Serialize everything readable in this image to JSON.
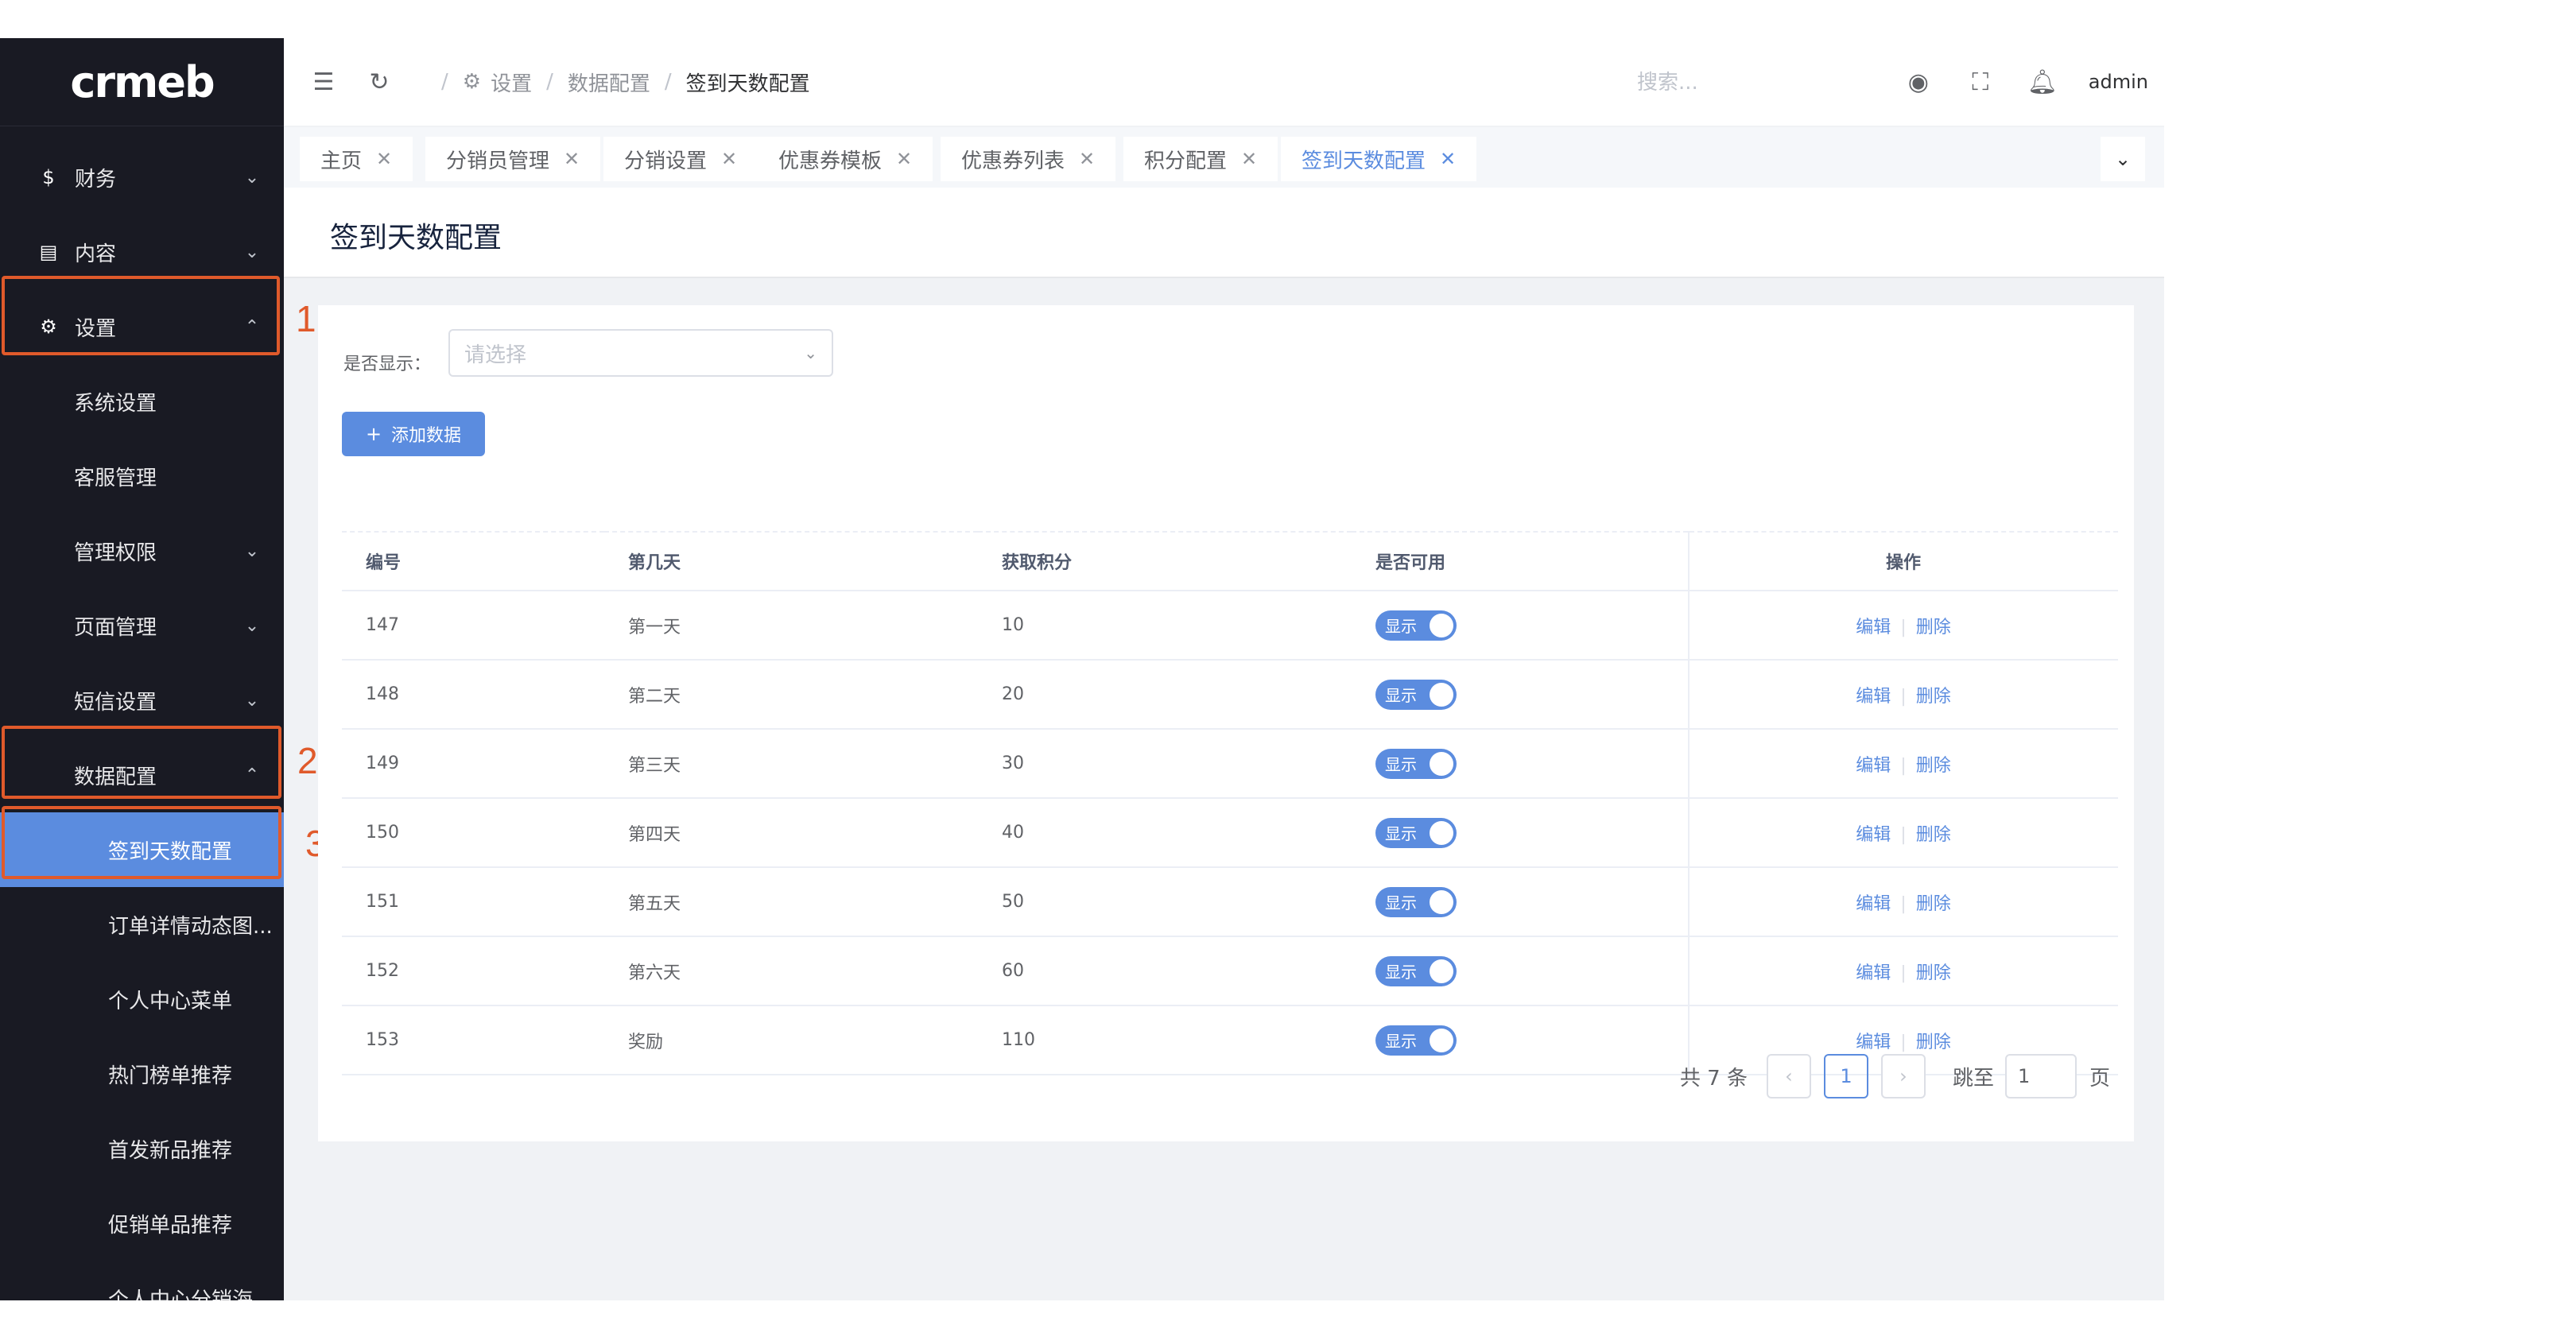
{
  "sidebar": {
    "logo": "crmeb",
    "items": [
      {
        "label": "财务",
        "icon": "dollar-icon",
        "glyph": "$",
        "arrow": "⌄"
      },
      {
        "label": "内容",
        "icon": "book-icon",
        "glyph": "▤",
        "arrow": "⌄"
      },
      {
        "label": "设置",
        "icon": "gear-icon",
        "glyph": "⚙",
        "arrow": "⌃"
      },
      {
        "label": "系统设置"
      },
      {
        "label": "客服管理"
      },
      {
        "label": "管理权限",
        "arrow": "⌄"
      },
      {
        "label": "页面管理",
        "arrow": "⌄"
      },
      {
        "label": "短信设置",
        "arrow": "⌄"
      },
      {
        "label": "数据配置",
        "arrow": "⌃"
      },
      {
        "label": "签到天数配置"
      },
      {
        "label": "订单详情动态图..."
      },
      {
        "label": "个人中心菜单"
      },
      {
        "label": "热门榜单推荐"
      },
      {
        "label": "首发新品推荐"
      },
      {
        "label": "促销单品推荐"
      },
      {
        "label": "个人中心分销海报..."
      }
    ],
    "callouts": [
      "1",
      "2",
      "3"
    ]
  },
  "header": {
    "breadcrumb": [
      "设置",
      "数据配置",
      "签到天数配置"
    ],
    "search_placeholder": "搜索...",
    "user": "admin"
  },
  "tags": [
    "主页",
    "分销员管理",
    "分销设置",
    "优惠券模板",
    "优惠券列表",
    "积分配置",
    "签到天数配置"
  ],
  "page_title": "签到天数配置",
  "filter": {
    "label": "是否显示：",
    "placeholder": "请选择"
  },
  "add_button": "添加数据",
  "table": {
    "columns": [
      "编号",
      "第几天",
      "获取积分",
      "是否可用",
      "操作"
    ],
    "rows": [
      {
        "id": "147",
        "day": "第一天",
        "points": "10",
        "status": "显示"
      },
      {
        "id": "148",
        "day": "第二天",
        "points": "20",
        "status": "显示"
      },
      {
        "id": "149",
        "day": "第三天",
        "points": "30",
        "status": "显示"
      },
      {
        "id": "150",
        "day": "第四天",
        "points": "40",
        "status": "显示"
      },
      {
        "id": "151",
        "day": "第五天",
        "points": "50",
        "status": "显示"
      },
      {
        "id": "152",
        "day": "第六天",
        "points": "60",
        "status": "显示"
      },
      {
        "id": "153",
        "day": "奖励",
        "points": "110",
        "status": "显示"
      }
    ],
    "edit_label": "编辑",
    "delete_label": "删除"
  },
  "pagination": {
    "total": "共 7 条",
    "current": "1",
    "jump_label": "跳至",
    "jump_value": "1",
    "unit": "页"
  },
  "colors": {
    "accent": "#5b8cdf",
    "sidebar_bg": "#191a23",
    "highlight": "#e05a2b"
  }
}
